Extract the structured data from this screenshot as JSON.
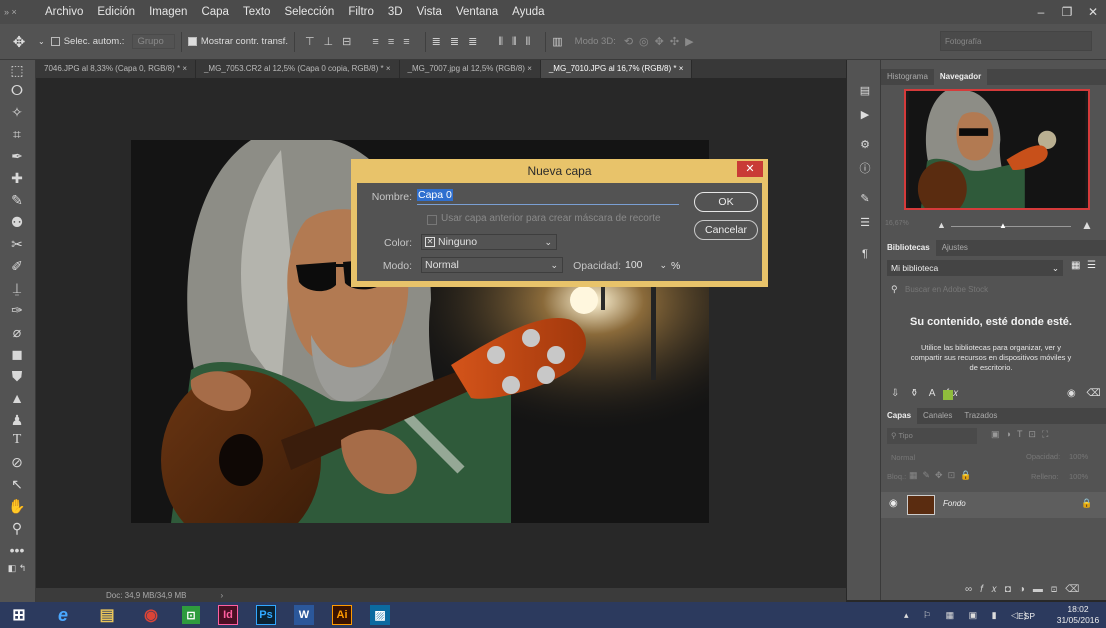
{
  "menu": {
    "app_mini": "Ps",
    "items": [
      "Archivo",
      "Edición",
      "Imagen",
      "Capa",
      "Texto",
      "Selección",
      "Filtro",
      "3D",
      "Vista",
      "Ventana",
      "Ayuda"
    ]
  },
  "window_controls": {
    "minimize": "–",
    "restore": "❐",
    "close": "✕"
  },
  "options": {
    "auto_select": "Selec. autom.:",
    "group": "Grupo",
    "show_transform": "Mostrar contr. transf.",
    "mode3d": "Modo 3D:",
    "workspace": "Fotografía"
  },
  "tabs": [
    {
      "label": "7046.JPG al 8,33% (Capa 0, RGB/8) *",
      "active": false
    },
    {
      "label": "_MG_7053.CR2 al 12,5% (Capa 0 copia, RGB/8) *",
      "active": false
    },
    {
      "label": "_MG_7007.jpg al 12,5% (RGB/8)",
      "active": false
    },
    {
      "label": "_MG_7010.JPG al 16,7% (RGB/8) *",
      "active": true
    }
  ],
  "tab_close": "×",
  "status": {
    "doc": "Doc: 34,9 MB/34,9 MB"
  },
  "dialog": {
    "title": "Nueva capa",
    "close": "✕",
    "name_label": "Nombre:",
    "name_value": "Capa 0",
    "clip_mask": "Usar capa anterior para crear máscara de recorte",
    "color_label": "Color:",
    "color_value": "Ninguno",
    "mode_label": "Modo:",
    "mode_value": "Normal",
    "opacity_label": "Opacidad:",
    "opacity_value": "100",
    "opacity_unit": "%",
    "ok": "OK",
    "cancel": "Cancelar"
  },
  "navigator": {
    "tabs": [
      "Histograma",
      "Navegador"
    ],
    "zoom": "16,67%"
  },
  "libraries": {
    "tabs": [
      "Bibliotecas",
      "Ajustes"
    ],
    "library": "Mi biblioteca",
    "search_placeholder": "Buscar en Adobe Stock",
    "headline": "Su contenido, esté donde esté.",
    "description": "Utilice las bibliotecas para organizar, ver y compartir sus recursos en dispositivos móviles y de escritorio."
  },
  "layers": {
    "tabs": [
      "Capas",
      "Canales",
      "Trazados"
    ],
    "filter": "Tipo",
    "blend": "Normal",
    "opacity_label": "Opacidad:",
    "opacity_value": "100%",
    "lock_label": "Bloq.:",
    "fill_label": "Relleno:",
    "fill_value": "100%",
    "layer_name": "Fondo"
  },
  "taskbar": {
    "apps": [
      {
        "name": "edge",
        "label": "e",
        "color": "#1e90ff"
      },
      {
        "name": "files",
        "label": "",
        "color": "#e8c45a"
      },
      {
        "name": "chrome",
        "label": "",
        "color": "#db4437"
      },
      {
        "name": "store",
        "label": "",
        "color": "#2e9b3e"
      },
      {
        "name": "indesign",
        "label": "Id",
        "color": "#4a0f24"
      },
      {
        "name": "photoshop",
        "label": "Ps",
        "color": "#0a2233"
      },
      {
        "name": "word",
        "label": "W",
        "color": "#2b579a"
      },
      {
        "name": "illustrator",
        "label": "Ai",
        "color": "#3a1200"
      },
      {
        "name": "photos",
        "label": "",
        "color": "#0b6aa0"
      }
    ],
    "lang": "ESP",
    "time": "18:02",
    "date": "31/05/2016"
  }
}
